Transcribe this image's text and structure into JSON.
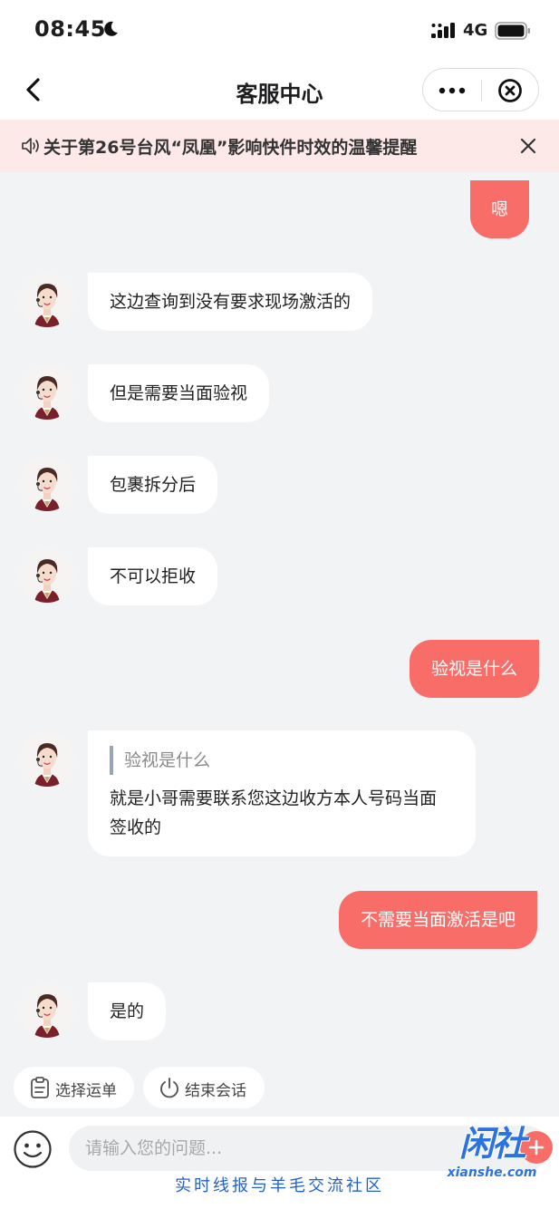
{
  "status_bar": {
    "time": "08:45",
    "network": "4G"
  },
  "nav": {
    "title": "客服中心"
  },
  "notice": {
    "text": "关于第26号台风“凤凰”影响快件时效的温馨提醒"
  },
  "messages": [
    {
      "side": "right",
      "text": "嗯"
    },
    {
      "side": "left",
      "text": "这边查询到没有要求现场激活的"
    },
    {
      "side": "left",
      "text": "但是需要当面验视"
    },
    {
      "side": "left",
      "text": "包裹拆分后"
    },
    {
      "side": "left",
      "text": "不可以拒收"
    },
    {
      "side": "right",
      "text": "验视是什么"
    },
    {
      "side": "left",
      "quote": "验视是什么",
      "text_lines": [
        "就是小哥需要联系您这边收方本人号码当面",
        "签收的"
      ]
    },
    {
      "side": "right",
      "text": "不需要当面激活是吧"
    },
    {
      "side": "left",
      "text": "是的"
    }
  ],
  "quick_actions": [
    {
      "label": "选择运单",
      "icon": "clipboard-icon"
    },
    {
      "label": "结束会话",
      "icon": "power-icon"
    }
  ],
  "input": {
    "placeholder": "请输入您的问题..."
  },
  "footer": {
    "slogan": "实时线报与羊毛交流社区",
    "watermark_logo": "闲社",
    "watermark_url": "xianshe.com"
  },
  "colors": {
    "accent": "#f96d68",
    "notice_bg": "#fde9e7",
    "chat_bg": "#f2f3f5",
    "slogan": "#2560c8"
  }
}
